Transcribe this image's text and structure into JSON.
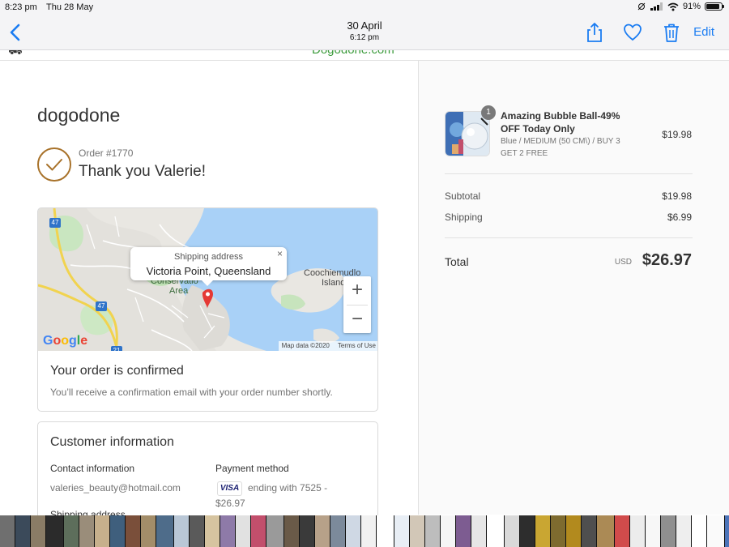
{
  "status": {
    "time": "8:23 pm",
    "date": "Thu 28 May",
    "battery": "91%",
    "battery_level": 0.91
  },
  "photo_header": {
    "title": "30 April",
    "subtitle": "6:12 pm",
    "edit_label": "Edit"
  },
  "url_peek": {
    "domain": "Dogodone.com"
  },
  "store": {
    "name": "dogodone"
  },
  "order": {
    "number": "Order #1770",
    "thanks": "Thank you Valerie!"
  },
  "map": {
    "popup_label": "Shipping address",
    "popup_place": "Victoria Point, Queensland",
    "place_conservation": "Conservatio",
    "place_area": "Area",
    "place_coochie": "Coochiemudlo",
    "place_island": "Island",
    "road_47a": "47",
    "road_47b": "47",
    "road_21": "21",
    "google": "Google",
    "map_data": "Map data ©2020",
    "terms": "Terms of Use",
    "zoom_in": "+",
    "zoom_out": "−",
    "close": "×"
  },
  "confirmation": {
    "title": "Your order is confirmed",
    "text": "You’ll receive a confirmation email with your order number shortly."
  },
  "customer": {
    "title": "Customer information",
    "contact_heading": "Contact information",
    "email": "valeries_beauty@hotmail.com",
    "payment_heading": "Payment method",
    "card_brand": "VISA",
    "card_ending": "ending with 7525 -",
    "amount": "$26.97",
    "shipping_heading": "Shipping address"
  },
  "summary": {
    "product": {
      "name": "Amazing Bubble Ball-49% OFF Today Only",
      "variant": "Blue / MEDIUM (50 CM\\) / BUY 3 GET 2 FREE",
      "price": "$19.98",
      "quantity": "1"
    },
    "subtotal_label": "Subtotal",
    "subtotal_value": "$19.98",
    "shipping_label": "Shipping",
    "shipping_value": "$6.99",
    "total_label": "Total",
    "currency": "USD",
    "total_value": "$26.97"
  },
  "colors": {
    "accent_blue": "#1a7cf2",
    "check_brown": "#a8722a",
    "pin_red": "#e53935"
  },
  "strip_colors": [
    "#6f6f6f",
    "#3b4a5a",
    "#8a7c66",
    "#2b2b2b",
    "#5d6e5b",
    "#9a8d7a",
    "#c7b08c",
    "#3f5f7d",
    "#7a4f3a",
    "#a38d69",
    "#4e6c8a",
    "#b9c7d6",
    "#5a5a5a",
    "#d6c4a0",
    "#8e7aa8",
    "#e1e1e1",
    "#c24f6c",
    "#9a9a9a",
    "#6a5a48",
    "#3a3a3a",
    "#b7a189",
    "#7c8a9b",
    "#cfd8e4",
    "#f1f1f1",
    "#ffffff",
    "#e8eef5",
    "#d2c7b7",
    "#bdbdbd",
    "#f5f5f5",
    "#7d5c91",
    "#e6e6e6",
    "#ffffff",
    "#d9d9d9",
    "#2d2d2d",
    "#c9a632",
    "#7e6b2f",
    "#b28a1e",
    "#4f4f4f",
    "#ab8a55",
    "#d14b4b",
    "#ececec",
    "#f7f7f7",
    "#8f8f8f",
    "#eeeeee",
    "#ffffff",
    "#fafafa",
    "#4c74b9",
    "#eeeeee",
    "#f0f0f0",
    "#ffffff",
    "#dddddd",
    "#c84444",
    "#ffffff",
    "#eaeaea",
    "#ffffff",
    "#a4a4a4",
    "#e9e9e9",
    "#ffffff",
    "#cfcfcf",
    "#333333",
    "#f3f3f3",
    "#ffffff",
    "#bcbcbc",
    "#e5e5e5",
    "#5a5a5a",
    "#3e3e3e"
  ]
}
